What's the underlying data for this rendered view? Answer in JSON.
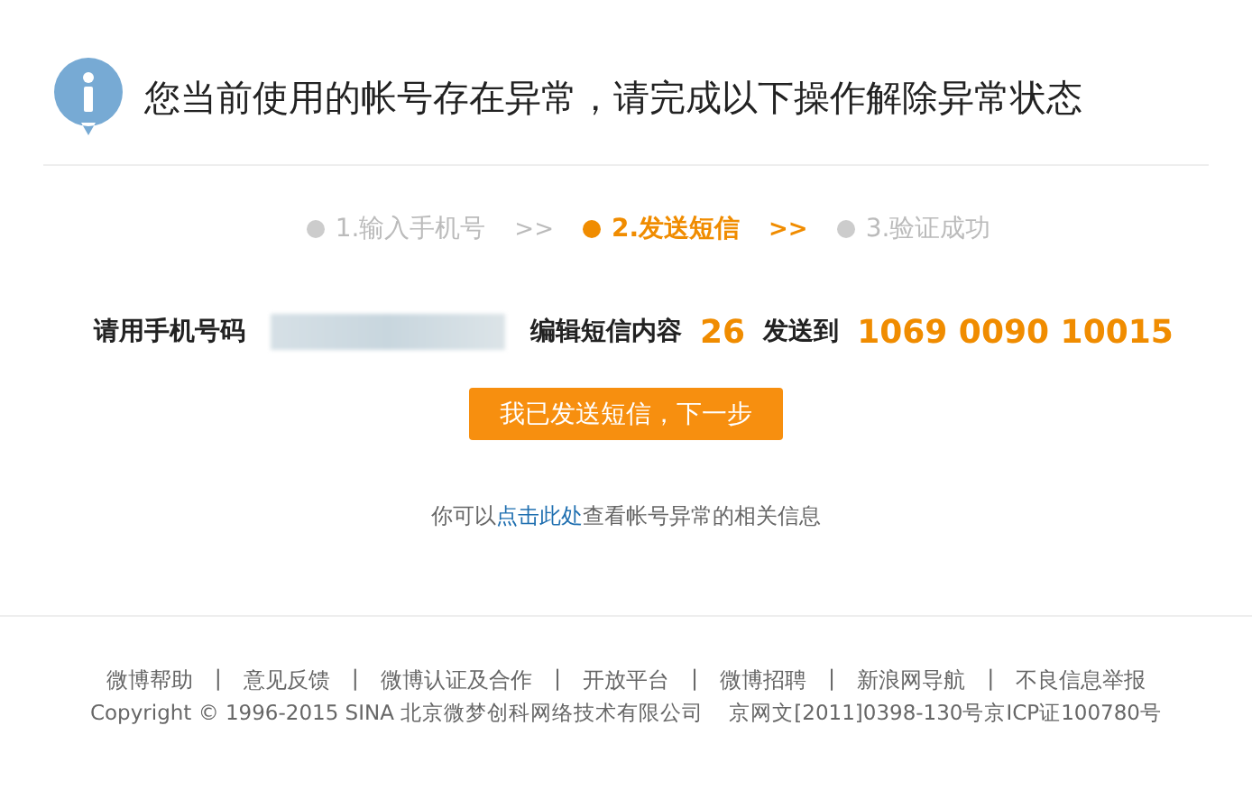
{
  "header": {
    "title": "您当前使用的帐号存在异常，请完成以下操作解除异常状态"
  },
  "steps": [
    {
      "label": "1.输入手机号",
      "selected": false
    },
    {
      "label": "2.发送短信",
      "selected": true
    },
    {
      "label": "3.验证成功",
      "selected": false
    }
  ],
  "step_separators": [
    {
      "text": ">>",
      "active": false
    },
    {
      "text": ">>",
      "active": true
    }
  ],
  "instruction": {
    "prefix": "请用手机号码",
    "middle": "编辑短信内容",
    "code": "26",
    "to_label": "发送到",
    "number": "1069 0090 10015"
  },
  "next_button": "我已发送短信，下一步",
  "help": {
    "before": "你可以",
    "link": "点击此处",
    "after": "查看帐号异常的相关信息"
  },
  "footer": {
    "links": [
      "微博帮助",
      "意见反馈",
      "微博认证及合作",
      "开放平台",
      "微博招聘",
      "新浪网导航",
      "不良信息举报"
    ],
    "separator": "|",
    "copyright": "Copyright © 1996-2015 SINA 北京微梦创科网络技术有限公司",
    "license": "京网文[2011]0398-130号京ICP证100780号"
  }
}
